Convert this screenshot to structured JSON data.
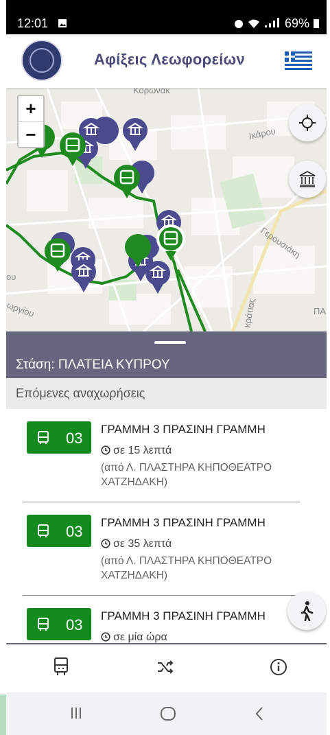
{
  "status_bar": {
    "time": "12:01",
    "battery": "69%"
  },
  "header": {
    "title": "Αφίξεις Λεωφορείων",
    "language": "greek-flag"
  },
  "map": {
    "zoom_in": "+",
    "zoom_out": "−",
    "labels": {
      "korwnaki": "Κορωνάκ",
      "ikarou": "Ικάρου",
      "gerousiakis": "Γερουσιάκη",
      "kratias": "κράτιας",
      "pa": "ΠΑ",
      "ou": "ου",
      "porg": "ωργίου"
    },
    "route_color": "#1f8a1f",
    "bus_marker_color": "#1f8a1f",
    "museum_marker_color": "#4b4a8f"
  },
  "sheet": {
    "stop_label": "Στάση: ΠΛΑΤΕΙΑ ΚΥΠΡΟΥ",
    "subtitle": "Επόμενες αναχωρήσεις"
  },
  "departures": [
    {
      "line": "03",
      "name": "ΓΡΑΜΜΗ 3 ΠΡΑΣΙΝΗ ΓΡΑΜΜΗ",
      "eta": "σε 15 λεπτά",
      "from": "(από Λ. ΠΛΑΣΤΗΡΑ ΚΗΠΟΘΕΑΤΡΟ ΧΑΤΖΗΔΑΚΗ)"
    },
    {
      "line": "03",
      "name": "ΓΡΑΜΜΗ 3 ΠΡΑΣΙΝΗ ΓΡΑΜΜΗ",
      "eta": "σε 35 λεπτά",
      "from": "(από Λ. ΠΛΑΣΤΗΡΑ ΚΗΠΟΘΕΑΤΡΟ ΧΑΤΖΗΔΑΚΗ)"
    },
    {
      "line": "03",
      "name": "ΓΡΑΜΜΗ 3 ΠΡΑΣΙΝΗ ΓΡΑΜΜΗ",
      "eta": "σε μία ώρα",
      "from": ""
    }
  ],
  "bottom_nav": {
    "tabs": [
      "bus-icon",
      "shuffle-icon",
      "info-icon"
    ]
  },
  "colors": {
    "accent_green": "#138a1e",
    "sheet_header": "#66677f",
    "title": "#4a4a78"
  }
}
